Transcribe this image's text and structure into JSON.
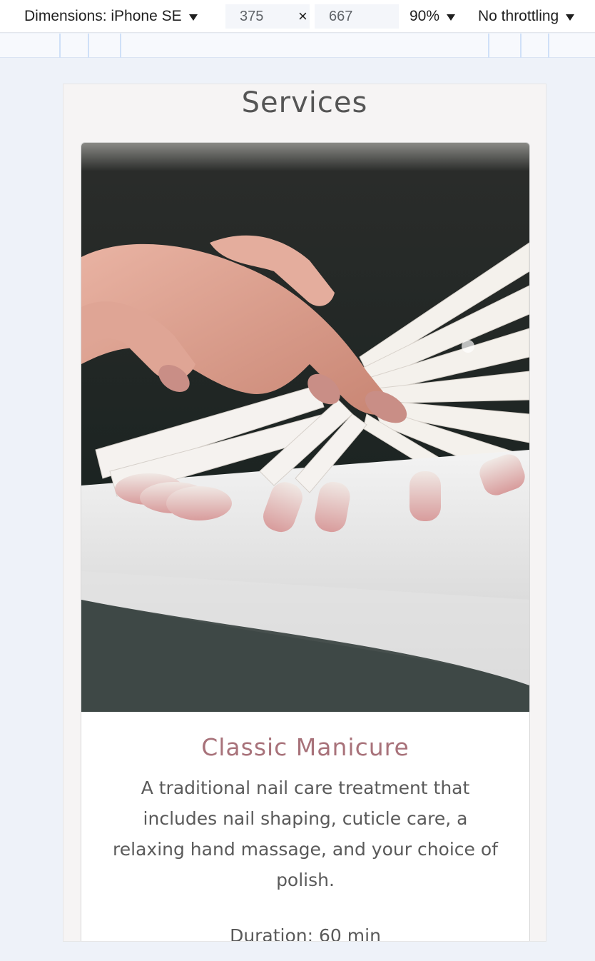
{
  "toolbar": {
    "dimensions_label": "Dimensions: iPhone SE",
    "width_value": "375",
    "height_value": "667",
    "times_symbol": "×",
    "zoom_label": "90%",
    "throttling_label": "No throttling"
  },
  "page": {
    "section_title": "Services",
    "card": {
      "title": "Classic Manicure",
      "description": "A traditional nail care treatment that includes nail shaping, cuticle care, a relaxing hand massage, and your choice of polish.",
      "duration": "Duration: 60 min",
      "image_icon": "nail-swatches-photo"
    }
  },
  "colors": {
    "accent_title": "#a8727a",
    "viewport_bg": "#f6f4f4",
    "devtools_bg": "#eef2f9"
  }
}
